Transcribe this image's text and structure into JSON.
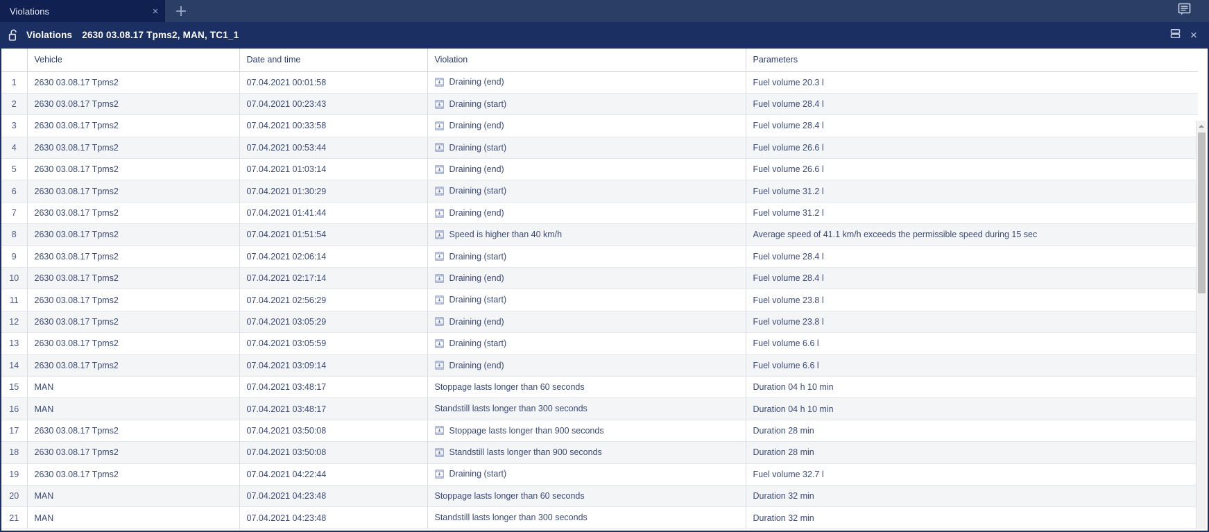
{
  "tabbar": {
    "tab_label": "Violations",
    "close_icon": "×",
    "add_icon": "plus-icon",
    "panel_icon": "messages-panel-icon"
  },
  "window": {
    "lock_icon": "unlocked-padlock-icon",
    "title": "Violations",
    "subtitle": "2630 03.08.17 Tpms2, MAN, TC1_1",
    "minimize_icon": "restore-window-icon",
    "close_icon": "×"
  },
  "table": {
    "columns": [
      "",
      "Vehicle",
      "Date and time",
      "Violation",
      "Parameters"
    ],
    "rows": [
      {
        "num": "1",
        "vehicle": "2630 03.08.17 Tpms2",
        "datetime": "07.04.2021 00:01:58",
        "violation": "Draining (end)",
        "icon": true,
        "parameters": "Fuel volume 20.3 l"
      },
      {
        "num": "2",
        "vehicle": "2630 03.08.17 Tpms2",
        "datetime": "07.04.2021 00:23:43",
        "violation": "Draining (start)",
        "icon": true,
        "parameters": "Fuel volume 28.4 l"
      },
      {
        "num": "3",
        "vehicle": "2630 03.08.17 Tpms2",
        "datetime": "07.04.2021 00:33:58",
        "violation": "Draining (end)",
        "icon": true,
        "parameters": "Fuel volume 28.4 l"
      },
      {
        "num": "4",
        "vehicle": "2630 03.08.17 Tpms2",
        "datetime": "07.04.2021 00:53:44",
        "violation": "Draining (start)",
        "icon": true,
        "parameters": "Fuel volume 26.6 l"
      },
      {
        "num": "5",
        "vehicle": "2630 03.08.17 Tpms2",
        "datetime": "07.04.2021 01:03:14",
        "violation": "Draining (end)",
        "icon": true,
        "parameters": "Fuel volume 26.6 l"
      },
      {
        "num": "6",
        "vehicle": "2630 03.08.17 Tpms2",
        "datetime": "07.04.2021 01:30:29",
        "violation": "Draining (start)",
        "icon": true,
        "parameters": "Fuel volume 31.2 l"
      },
      {
        "num": "7",
        "vehicle": "2630 03.08.17 Tpms2",
        "datetime": "07.04.2021 01:41:44",
        "violation": "Draining (end)",
        "icon": true,
        "parameters": "Fuel volume 31.2 l"
      },
      {
        "num": "8",
        "vehicle": "2630 03.08.17 Tpms2",
        "datetime": "07.04.2021 01:51:54",
        "violation": "Speed is higher than 40 km/h",
        "icon": true,
        "parameters": "Average speed of 41.1 km/h exceeds the permissible speed during 15 sec"
      },
      {
        "num": "9",
        "vehicle": "2630 03.08.17 Tpms2",
        "datetime": "07.04.2021 02:06:14",
        "violation": "Draining (start)",
        "icon": true,
        "parameters": "Fuel volume 28.4 l"
      },
      {
        "num": "10",
        "vehicle": "2630 03.08.17 Tpms2",
        "datetime": "07.04.2021 02:17:14",
        "violation": "Draining (end)",
        "icon": true,
        "parameters": "Fuel volume 28.4 l"
      },
      {
        "num": "11",
        "vehicle": "2630 03.08.17 Tpms2",
        "datetime": "07.04.2021 02:56:29",
        "violation": "Draining (start)",
        "icon": true,
        "parameters": "Fuel volume 23.8 l"
      },
      {
        "num": "12",
        "vehicle": "2630 03.08.17 Tpms2",
        "datetime": "07.04.2021 03:05:29",
        "violation": "Draining (end)",
        "icon": true,
        "parameters": "Fuel volume 23.8 l"
      },
      {
        "num": "13",
        "vehicle": "2630 03.08.17 Tpms2",
        "datetime": "07.04.2021 03:05:59",
        "violation": "Draining (start)",
        "icon": true,
        "parameters": "Fuel volume 6.6 l"
      },
      {
        "num": "14",
        "vehicle": "2630 03.08.17 Tpms2",
        "datetime": "07.04.2021 03:09:14",
        "violation": "Draining (end)",
        "icon": true,
        "parameters": "Fuel volume 6.6 l"
      },
      {
        "num": "15",
        "vehicle": "MAN",
        "datetime": "07.04.2021 03:48:17",
        "violation": "Stoppage lasts longer than 60 seconds",
        "icon": false,
        "parameters": "Duration 04 h 10 min"
      },
      {
        "num": "16",
        "vehicle": "MAN",
        "datetime": "07.04.2021 03:48:17",
        "violation": "Standstill lasts longer than 300 seconds",
        "icon": false,
        "parameters": "Duration 04 h 10 min"
      },
      {
        "num": "17",
        "vehicle": "2630 03.08.17 Tpms2",
        "datetime": "07.04.2021 03:50:08",
        "violation": "Stoppage lasts longer than 900 seconds",
        "icon": true,
        "parameters": "Duration 28 min"
      },
      {
        "num": "18",
        "vehicle": "2630 03.08.17 Tpms2",
        "datetime": "07.04.2021 03:50:08",
        "violation": "Standstill lasts longer than 900 seconds",
        "icon": true,
        "parameters": "Duration 28 min"
      },
      {
        "num": "19",
        "vehicle": "2630 03.08.17 Tpms2",
        "datetime": "07.04.2021 04:22:44",
        "violation": "Draining (start)",
        "icon": true,
        "parameters": "Fuel volume 32.7 l"
      },
      {
        "num": "20",
        "vehicle": "MAN",
        "datetime": "07.04.2021 04:23:48",
        "violation": "Stoppage lasts longer than 60 seconds",
        "icon": false,
        "parameters": "Duration 32 min"
      },
      {
        "num": "21",
        "vehicle": "MAN",
        "datetime": "07.04.2021 04:23:48",
        "violation": "Standstill lasts longer than 300 seconds",
        "icon": false,
        "parameters": "Duration 32 min"
      }
    ]
  },
  "scrollbar": {
    "up_icon": "scroll-up-arrow-icon"
  },
  "colors": {
    "tabstrip_bg": "#2b3f66",
    "tab_active_bg": "#102050",
    "window_bar_bg": "#1b2f63",
    "text_primary": "#3b4a76",
    "row_alt_bg": "#f4f5f7"
  }
}
